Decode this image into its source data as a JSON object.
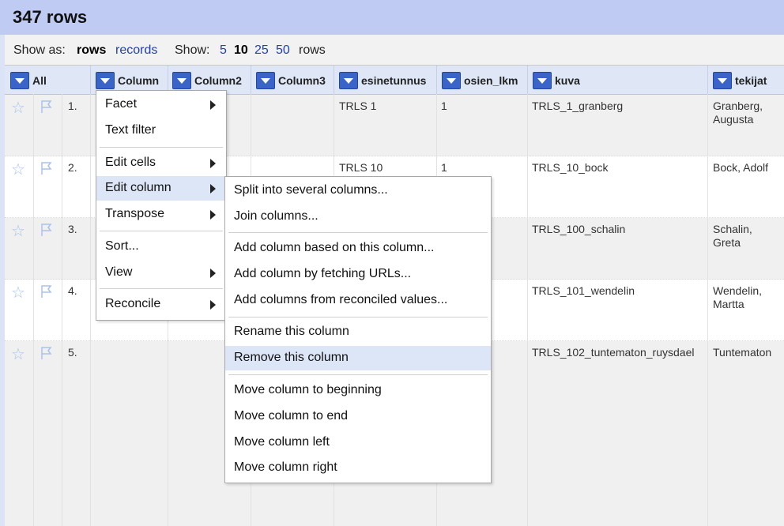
{
  "title": "347 rows",
  "controls": {
    "show_as_label": "Show as:",
    "rows_mode": "rows",
    "records_mode": "records",
    "show_label": "Show:",
    "page_sizes": [
      "5",
      "10",
      "25",
      "50"
    ],
    "selected_page_size": "10",
    "rows_suffix": "rows"
  },
  "columns": {
    "all": "All",
    "column": "Column",
    "column2": "Column2",
    "column3": "Column3",
    "esinetunnus": "esinetunnus",
    "osien_lkm": "osien_lkm",
    "kuva": "kuva",
    "tekijat": "tekijat"
  },
  "rows": [
    {
      "num": "1.",
      "esinetunnus": "TRLS 1",
      "osien_lkm": "1",
      "kuva": "TRLS_1_granberg",
      "tekijat": "Granberg, Augusta"
    },
    {
      "num": "2.",
      "esinetunnus": "TRLS 10",
      "osien_lkm": "1",
      "kuva": "TRLS_10_bock",
      "tekijat": "Bock, Adolf"
    },
    {
      "num": "3.",
      "esinetunnus": "",
      "osien_lkm": "",
      "kuva": "TRLS_100_schalin",
      "tekijat": "Schalin, Greta"
    },
    {
      "num": "4.",
      "esinetunnus": "",
      "osien_lkm": "",
      "kuva": "TRLS_101_wendelin",
      "tekijat": "Wendelin, Martta"
    },
    {
      "num": "5.",
      "esinetunnus": "",
      "osien_lkm": "",
      "kuva": "TRLS_102_tuntematon_ruysdael",
      "tekijat": "Tuntematon"
    }
  ],
  "column_menu": {
    "facet": "Facet",
    "text_filter": "Text filter",
    "edit_cells": "Edit cells",
    "edit_column": "Edit column",
    "transpose": "Transpose",
    "sort": "Sort...",
    "view": "View",
    "reconcile": "Reconcile"
  },
  "edit_column_menu": {
    "split": "Split into several columns...",
    "join": "Join columns...",
    "add_based": "Add column based on this column...",
    "add_fetch": "Add column by fetching URLs...",
    "add_reconciled": "Add columns from reconciled values...",
    "rename": "Rename this column",
    "remove": "Remove this column",
    "move_beginning": "Move column to beginning",
    "move_end": "Move column to end",
    "move_left": "Move column left",
    "move_right": "Move column right"
  },
  "colors": {
    "title_bar": "#bfcbf2",
    "dropdown_button": "#3a64c8",
    "link": "#2040b0",
    "menu_hover": "#dde6f6"
  }
}
